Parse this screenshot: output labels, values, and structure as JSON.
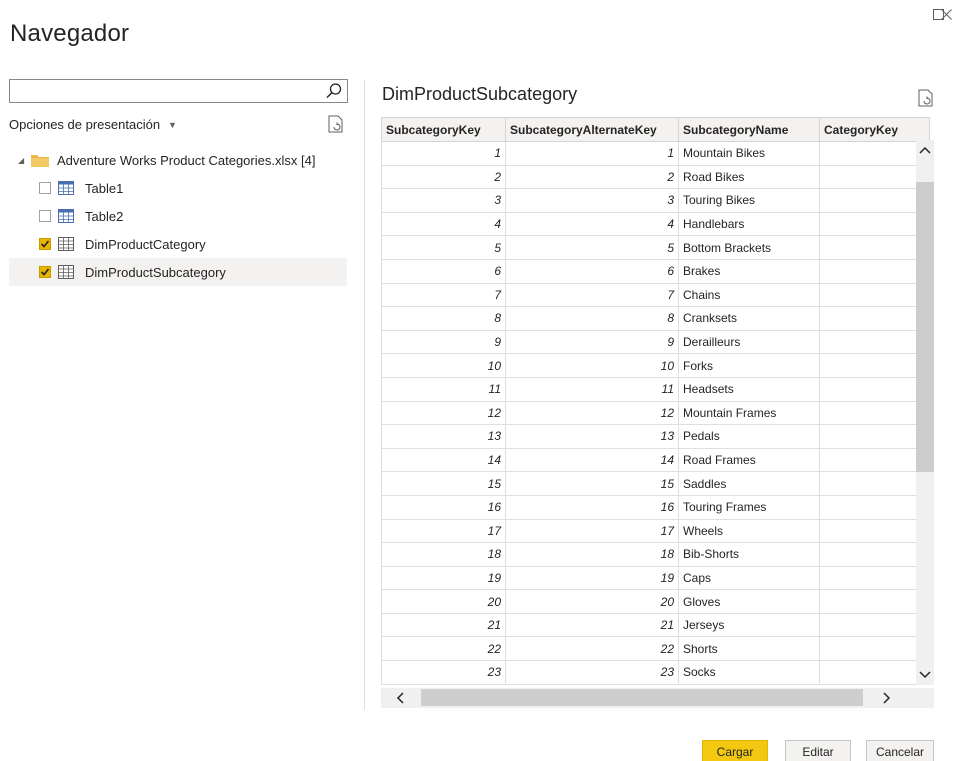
{
  "window": {
    "maximize_icon": "maximize-icon",
    "close_icon": "close-icon"
  },
  "title": "Navegador",
  "left": {
    "search": {
      "placeholder": "",
      "value": ""
    },
    "display_options_label": "Opciones de presentación",
    "tree": {
      "root_label": "Adventure Works Product Categories.xlsx [4]",
      "items": [
        {
          "label": "Table1",
          "checked": false,
          "kind": "table"
        },
        {
          "label": "Table2",
          "checked": false,
          "kind": "table"
        },
        {
          "label": "DimProductCategory",
          "checked": true,
          "kind": "sheet"
        },
        {
          "label": "DimProductSubcategory",
          "checked": true,
          "kind": "sheet",
          "selected": true
        }
      ]
    }
  },
  "preview": {
    "title": "DimProductSubcategory",
    "columns": [
      "SubcategoryKey",
      "SubcategoryAlternateKey",
      "SubcategoryName",
      "CategoryKey"
    ],
    "rows": [
      [
        "1",
        "1",
        "Mountain Bikes",
        ""
      ],
      [
        "2",
        "2",
        "Road Bikes",
        ""
      ],
      [
        "3",
        "3",
        "Touring Bikes",
        ""
      ],
      [
        "4",
        "4",
        "Handlebars",
        ""
      ],
      [
        "5",
        "5",
        "Bottom Brackets",
        ""
      ],
      [
        "6",
        "6",
        "Brakes",
        ""
      ],
      [
        "7",
        "7",
        "Chains",
        ""
      ],
      [
        "8",
        "8",
        "Cranksets",
        ""
      ],
      [
        "9",
        "9",
        "Derailleurs",
        ""
      ],
      [
        "10",
        "10",
        "Forks",
        ""
      ],
      [
        "11",
        "11",
        "Headsets",
        ""
      ],
      [
        "12",
        "12",
        "Mountain Frames",
        ""
      ],
      [
        "13",
        "13",
        "Pedals",
        ""
      ],
      [
        "14",
        "14",
        "Road Frames",
        ""
      ],
      [
        "15",
        "15",
        "Saddles",
        ""
      ],
      [
        "16",
        "16",
        "Touring Frames",
        ""
      ],
      [
        "17",
        "17",
        "Wheels",
        ""
      ],
      [
        "18",
        "18",
        "Bib-Shorts",
        ""
      ],
      [
        "19",
        "19",
        "Caps",
        ""
      ],
      [
        "20",
        "20",
        "Gloves",
        ""
      ],
      [
        "21",
        "21",
        "Jerseys",
        ""
      ],
      [
        "22",
        "22",
        "Shorts",
        ""
      ],
      [
        "23",
        "23",
        "Socks",
        ""
      ]
    ]
  },
  "footer": {
    "load_label": "Cargar",
    "edit_label": "Editar",
    "cancel_label": "Cancelar"
  },
  "colors": {
    "accent": "#f2c811",
    "checkbox": "#e7b400",
    "selected_row": "#f3f2f1"
  }
}
